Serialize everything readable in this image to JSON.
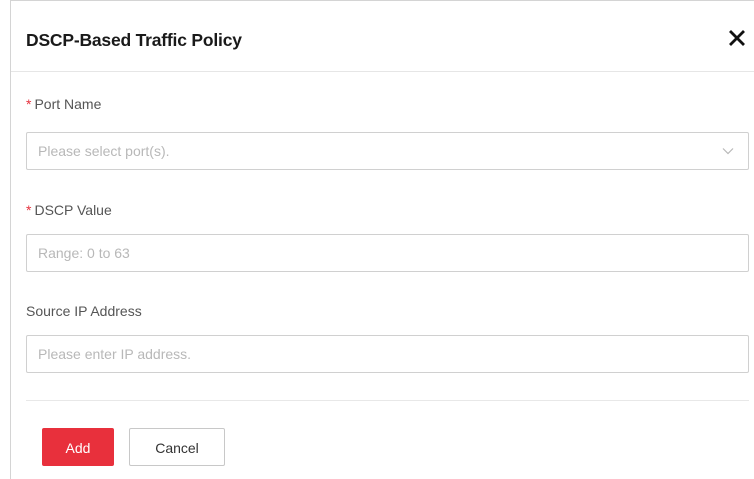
{
  "dialog": {
    "title": "DSCP-Based Traffic Policy",
    "close_icon": "close-icon"
  },
  "form": {
    "port_name": {
      "label": "Port Name",
      "required_mark": "*",
      "placeholder": "Please select port(s).",
      "icon": "chevron-down-icon"
    },
    "dscp_value": {
      "label": "DSCP Value",
      "required_mark": "*",
      "placeholder": "Range: 0 to 63"
    },
    "source_ip": {
      "label": "Source IP Address",
      "placeholder": "Please enter IP address."
    }
  },
  "footer": {
    "add_label": "Add",
    "cancel_label": "Cancel"
  },
  "colors": {
    "accent": "#e8303c",
    "required": "#e5323e",
    "placeholder": "#b8b8b8"
  }
}
